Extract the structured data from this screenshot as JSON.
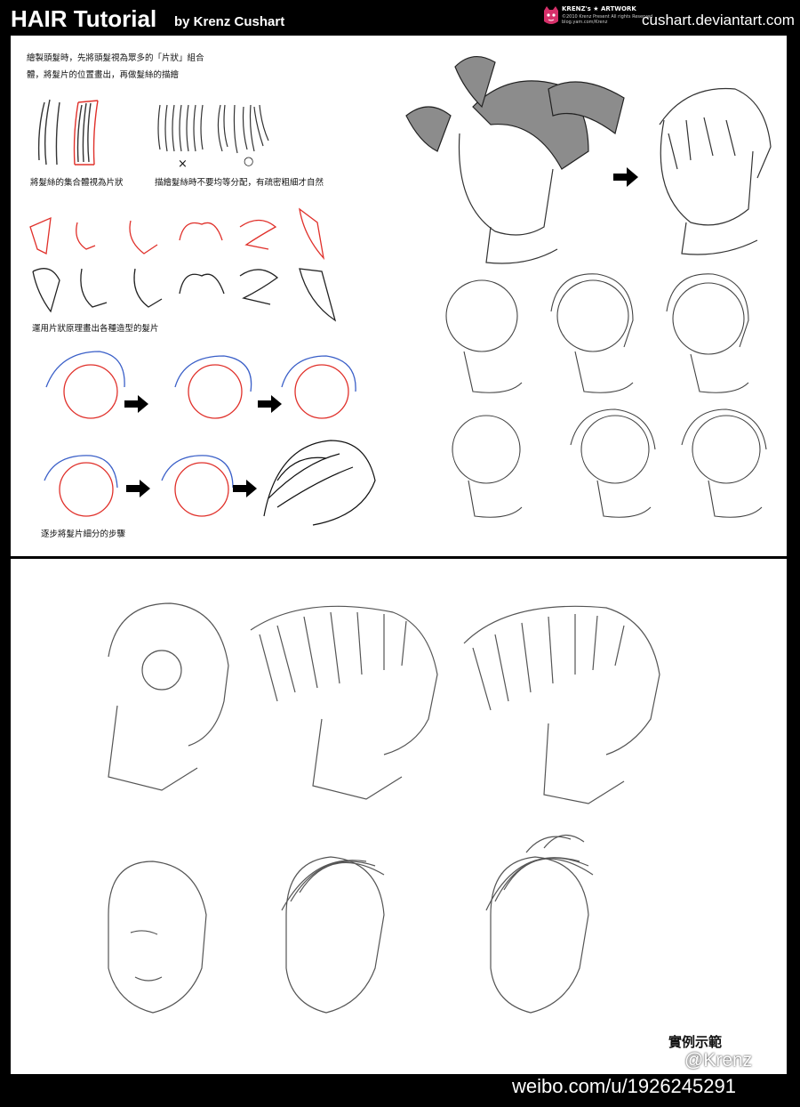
{
  "header": {
    "title": "HAIR Tutorial",
    "byline": "by Krenz Cushart",
    "logo_text": "KRENZ's ★ ARTWORK",
    "logo_subtext": "©2010 Krenz Present All rights Reserved",
    "logo_subtext2": "blog.yam.com/Krenz",
    "site": "cushart.deviantart.com"
  },
  "panel1": {
    "intro_line1": "繪製頭髮時，先將頭髮視為眾多的「片狀」組合",
    "intro_line2": "體，將髮片的位置畫出，再做髮絲的描繪",
    "label_strands": "將髮絲的集合體視為片狀",
    "label_distribution": "描繪髮絲時不要均等分配，有疏密粗細才自然",
    "mark_x": "×",
    "mark_o": "○",
    "label_shapes": "運用片狀原理畫出各種造型的髮片",
    "label_steps": "逐步將髮片細分的步驟"
  },
  "panel2": {
    "caption": "實例示範"
  },
  "footer": {
    "weibo_handle": "@Krenz",
    "weibo_url": "weibo.com/u/1926245291"
  },
  "colors": {
    "background": "#000000",
    "panel": "#ffffff",
    "sketch_red": "#e0302a",
    "sketch_blue": "#3a5fc8",
    "hair_gray": "#8c8c8c"
  }
}
